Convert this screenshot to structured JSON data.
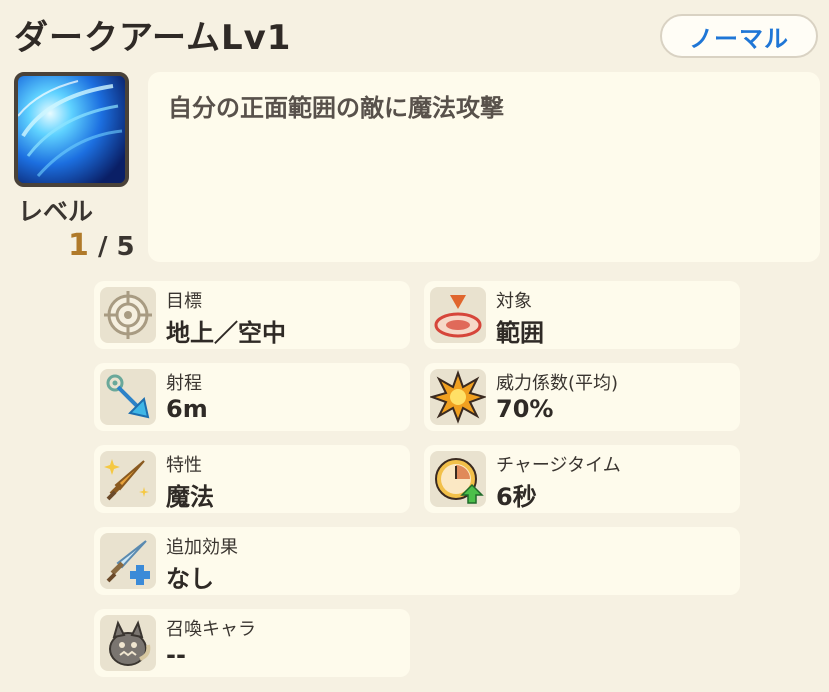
{
  "skill": {
    "title": "ダークアームLv1",
    "rarity": "ノーマル",
    "icon": "dark-arm-skill-icon",
    "level_label": "レベル",
    "level_current": "1",
    "level_max": "/ 5",
    "description": "自分の正面範囲の敵に魔法攻撃"
  },
  "stats": {
    "target": {
      "label": "目標",
      "value": "地上／空中",
      "icon": "crosshair-icon"
    },
    "object": {
      "label": "対象",
      "value": "範囲",
      "icon": "area-target-icon"
    },
    "range": {
      "label": "射程",
      "value": "6m",
      "icon": "range-arrow-icon"
    },
    "power": {
      "label": "威力係数(平均)",
      "value": "70%",
      "icon": "explosion-icon"
    },
    "trait": {
      "label": "特性",
      "value": "魔法",
      "icon": "sword-sparkle-icon"
    },
    "charge": {
      "label": "チャージタイム",
      "value": "6秒",
      "icon": "clock-up-icon"
    },
    "extra": {
      "label": "追加効果",
      "value": "なし",
      "icon": "sword-plus-icon"
    },
    "summon": {
      "label": "召喚キャラ",
      "value": "--",
      "icon": "summon-creature-icon"
    }
  },
  "colors": {
    "background": "#f6f1e2",
    "panel": "#fefbec",
    "rarity_text": "#1f76d6",
    "level_current": "#b07a2a"
  }
}
